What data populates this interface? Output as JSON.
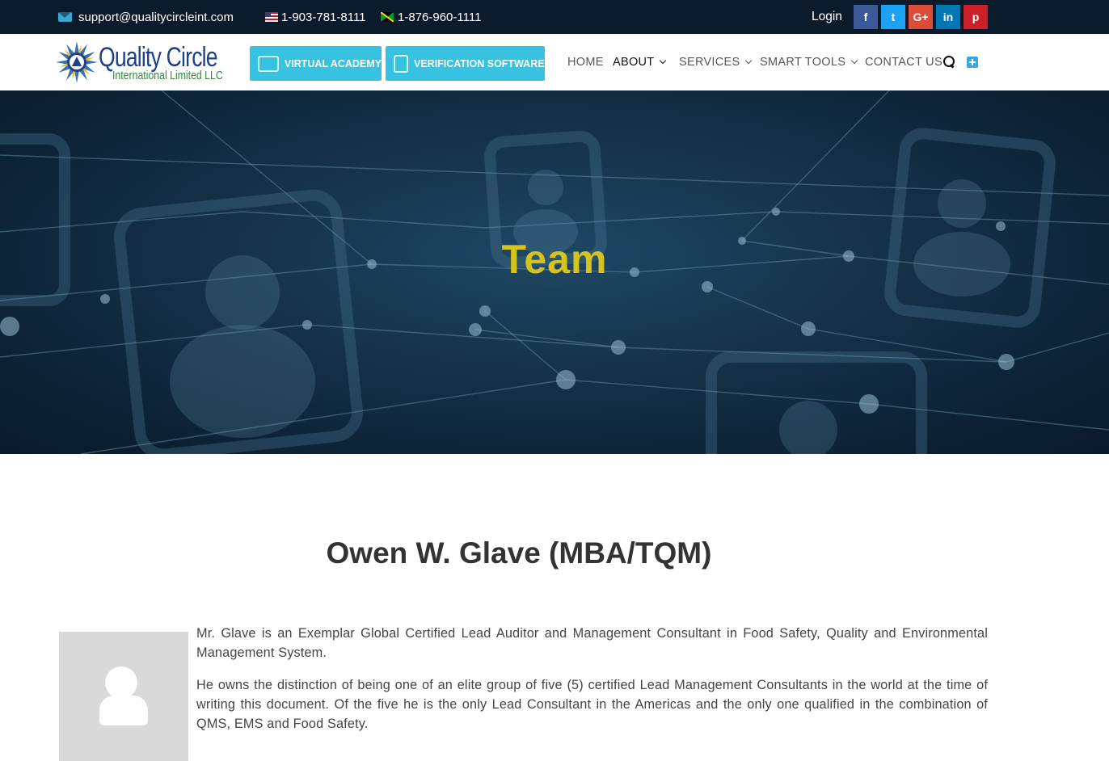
{
  "topbar": {
    "email": "support@qualitycircleint.com",
    "email_icon": "mail-icon",
    "phone_us": "1-903-781-8111",
    "phone_jm": "1-876-960-1111",
    "login": "Login",
    "social": [
      {
        "name": "facebook",
        "label": "f",
        "color": "#3b5998"
      },
      {
        "name": "twitter",
        "label": "t",
        "color": "#1da1f2"
      },
      {
        "name": "google-plus",
        "label": "G+",
        "color": "#dd4b39"
      },
      {
        "name": "linkedin",
        "label": "in",
        "color": "#0077b5"
      },
      {
        "name": "pinterest",
        "label": "p",
        "color": "#cb2027"
      }
    ]
  },
  "header": {
    "logo_line1": "Quality Circle",
    "logo_line2": "International Limited LLC",
    "cta_academy": "VIRTUAL ACADEMY",
    "cta_verification": "VERIFICATION SOFTWARE",
    "nav": {
      "home": "HOME",
      "about": "ABOUT",
      "services": "SERVICES",
      "smart_tools": "SMART TOOLS",
      "contact": "CONTACT US"
    }
  },
  "hero": {
    "title": "Team",
    "title_color": "#d6c41c"
  },
  "profile": {
    "name": "Owen W. Glave (MBA/TQM)",
    "avatar_icon": "user-placeholder-icon",
    "bio": [
      "Mr. Glave is an Exemplar Global Certified Lead Auditor and Management Consultant in Food Safety, Quality and Environmental Management System.",
      "He owns the distinction of being one of an elite group of five (5) certified Lead Management Consultants in the world at the time of writing this document. Of the five he is the only Lead Consultant in the Americas and the only one qualified in the combination of QMS, EMS and Food Safety."
    ]
  },
  "colors": {
    "topbar_bg": "#0c1b2c",
    "cta_bg": "#36c2e0",
    "accent_blue": "#36a8e0"
  }
}
